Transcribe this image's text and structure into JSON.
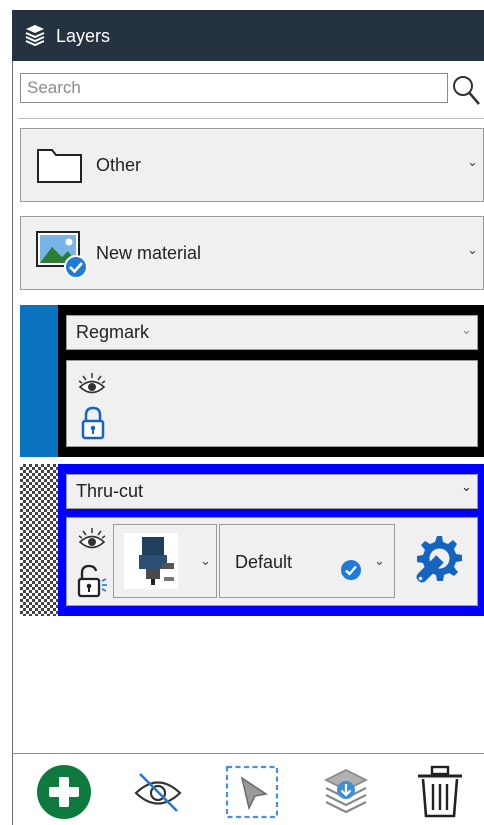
{
  "panel": {
    "title": "Layers",
    "icon": "layers-icon"
  },
  "search": {
    "placeholder": "Search",
    "value": ""
  },
  "layers": [
    {
      "label": "Other",
      "icon": "folder-icon"
    },
    {
      "label": "New material",
      "icon": "image-check-icon"
    }
  ],
  "regmark": {
    "label": "Regmark",
    "color": "#0a73c0",
    "frame_color": "#000000",
    "icons": [
      "visibility-icon",
      "lock-closed-icon"
    ]
  },
  "thrucut": {
    "label": "Thru-cut",
    "frame_color": "#0000ff",
    "tool_icon": "cutter-tool-icon",
    "mode": "Default",
    "icons": [
      "visibility-icon",
      "lock-open-icon",
      "settings-wrench-icon"
    ]
  },
  "toolbar": {
    "buttons": [
      "add-layer-icon",
      "hide-icon",
      "select-icon",
      "merge-layers-icon",
      "delete-icon"
    ]
  },
  "colors": {
    "header": "#253340",
    "add": "#0f7a3f",
    "check": "#1f7bd6",
    "blue": "#1565c0"
  }
}
